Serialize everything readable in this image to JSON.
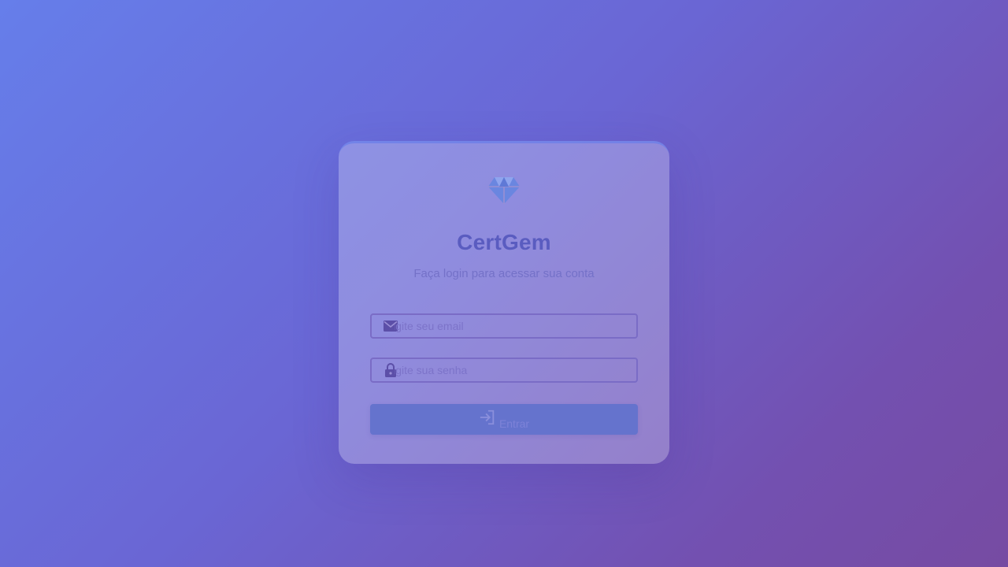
{
  "app": {
    "title": "CertGem",
    "subtitle": "Faça login para acessar sua conta",
    "logo_icon": "gem-icon"
  },
  "form": {
    "email": {
      "placeholder": "Digite seu email",
      "value": "",
      "icon": "envelope-icon"
    },
    "password": {
      "placeholder": "Digite sua senha",
      "value": "",
      "icon": "lock-icon"
    },
    "submit": {
      "label": "Entrar",
      "icon": "sign-in-icon"
    }
  },
  "colors": {
    "accent": "#667eea",
    "accent_secondary": "#764ba2",
    "title": "#5a5cc0",
    "button": "#6573cd"
  }
}
